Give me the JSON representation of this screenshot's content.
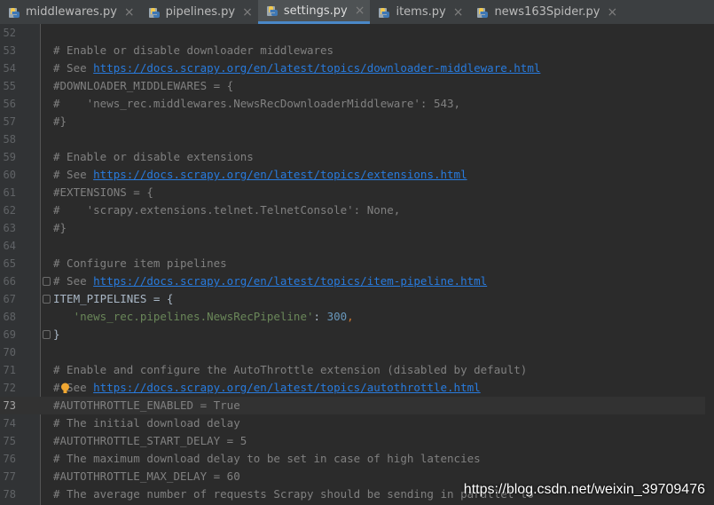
{
  "tabs": [
    {
      "label": "middlewares.py",
      "icon": "python-file-icon",
      "active": false
    },
    {
      "label": "pipelines.py",
      "icon": "python-file-icon",
      "active": false
    },
    {
      "label": "settings.py",
      "icon": "python-file-icon",
      "active": true
    },
    {
      "label": "items.py",
      "icon": "python-file-icon",
      "active": false
    },
    {
      "label": "news163Spider.py",
      "icon": "python-file-icon",
      "active": false
    }
  ],
  "close_glyph": "×",
  "colors": {
    "background": "#2b2b2b",
    "gutter": "#313335",
    "comment": "#808080",
    "link": "#287bde",
    "string": "#6a8759",
    "number": "#6897bb",
    "active_tab_underline": "#4a88c7"
  },
  "editor": {
    "current_line": 73,
    "lines": [
      {
        "n": "52",
        "text": ""
      },
      {
        "n": "53",
        "text": "# Enable or disable downloader middlewares"
      },
      {
        "n": "54",
        "text": "# See https://docs.scrapy.org/en/latest/topics/downloader-middleware.html"
      },
      {
        "n": "55",
        "text": "#DOWNLOADER_MIDDLEWARES = {"
      },
      {
        "n": "56",
        "text": "#    'news_rec.middlewares.NewsRecDownloaderMiddleware': 543,"
      },
      {
        "n": "57",
        "text": "#}"
      },
      {
        "n": "58",
        "text": ""
      },
      {
        "n": "59",
        "text": "# Enable or disable extensions"
      },
      {
        "n": "60",
        "text": "# See https://docs.scrapy.org/en/latest/topics/extensions.html"
      },
      {
        "n": "61",
        "text": "#EXTENSIONS = {"
      },
      {
        "n": "62",
        "text": "#    'scrapy.extensions.telnet.TelnetConsole': None,"
      },
      {
        "n": "63",
        "text": "#}"
      },
      {
        "n": "64",
        "text": ""
      },
      {
        "n": "65",
        "text": "# Configure item pipelines"
      },
      {
        "n": "66",
        "text": "# See https://docs.scrapy.org/en/latest/topics/item-pipeline.html"
      },
      {
        "n": "67",
        "text": "ITEM_PIPELINES = {"
      },
      {
        "n": "68",
        "text": "   'news_rec.pipelines.NewsRecPipeline': 300,"
      },
      {
        "n": "69",
        "text": "}"
      },
      {
        "n": "70",
        "text": ""
      },
      {
        "n": "71",
        "text": "# Enable and configure the AutoThrottle extension (disabled by default)"
      },
      {
        "n": "72",
        "text": "# See https://docs.scrapy.org/en/latest/topics/autothrottle.html"
      },
      {
        "n": "73",
        "text": "#AUTOTHROTTLE_ENABLED = True"
      },
      {
        "n": "74",
        "text": "# The initial download delay"
      },
      {
        "n": "75",
        "text": "#AUTOTHROTTLE_START_DELAY = 5"
      },
      {
        "n": "76",
        "text": "# The maximum download delay to be set in case of high latencies"
      },
      {
        "n": "77",
        "text": "#AUTOTHROTTLE_MAX_DELAY = 60"
      },
      {
        "n": "78",
        "text": "# The average number of requests Scrapy should be sending in parallel to"
      }
    ]
  },
  "watermark": "https://blog.csdn.net/weixin_39709476"
}
